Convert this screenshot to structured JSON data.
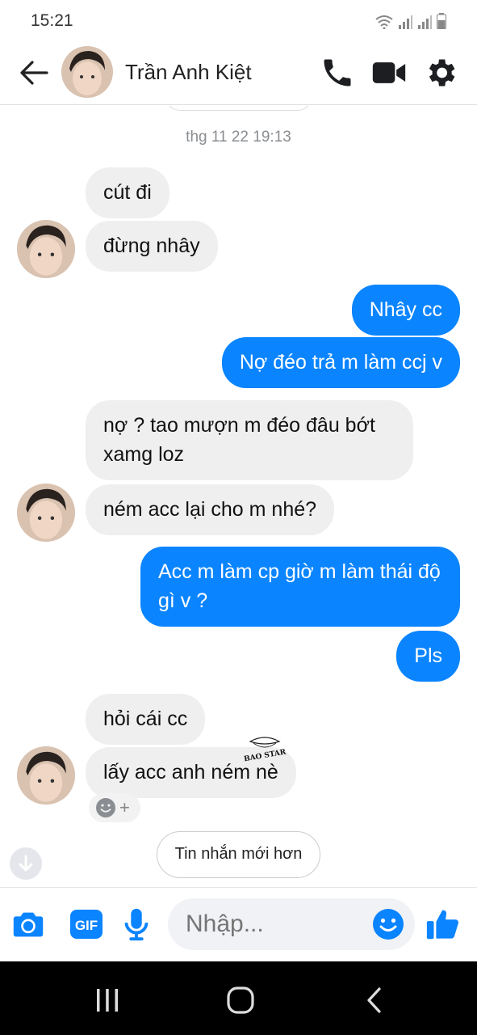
{
  "status_bar": {
    "time": "15:21"
  },
  "header": {
    "contact_name": "Trần Anh Kiệt"
  },
  "conversation": {
    "timestamp": "thg 11 22 19:13",
    "messages": [
      {
        "side": "in",
        "text": "cút đi"
      },
      {
        "side": "in",
        "text": "đừng nhây"
      },
      {
        "side": "out",
        "text": "Nhây cc"
      },
      {
        "side": "out",
        "text": "Nợ đéo trả m làm ccj v"
      },
      {
        "side": "in",
        "text": "nợ ? tao mượn m đéo đâu bớt xamg loz"
      },
      {
        "side": "in",
        "text": "ném acc lại cho m nhé?"
      },
      {
        "side": "out",
        "text": "Acc m làm cp giờ m làm thái độ gì v ?"
      },
      {
        "side": "out",
        "text": "Pls"
      },
      {
        "side": "in",
        "text": "hỏi cái cc"
      },
      {
        "side": "in",
        "text": "lấy acc anh ném nè"
      }
    ],
    "reaction_add": "+",
    "watermark": "BAO STAR",
    "new_messages_label": "Tin nhắn mới hơn"
  },
  "composer": {
    "placeholder": "Nhập...",
    "gif_label": "GIF"
  },
  "colors": {
    "accent": "#0a84ff",
    "incoming_bubble": "#efefef",
    "header_icons": "#1c1e21"
  }
}
